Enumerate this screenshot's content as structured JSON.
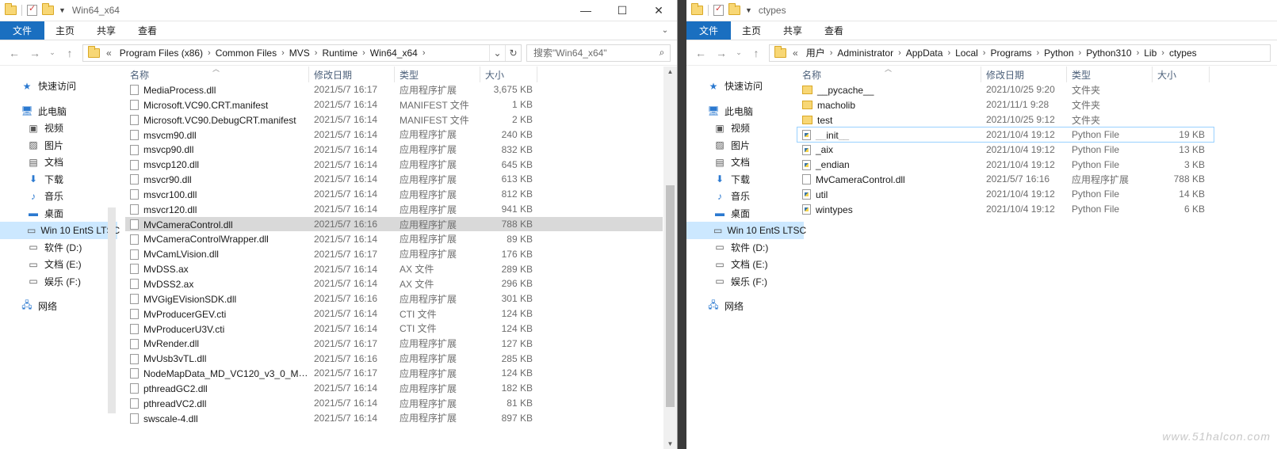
{
  "left": {
    "title": "Win64_x64",
    "ribbon": {
      "file": "文件",
      "tabs": [
        "主页",
        "共享",
        "查看"
      ]
    },
    "address": {
      "prefix": "«",
      "segments": [
        "Program Files (x86)",
        "Common Files",
        "MVS",
        "Runtime",
        "Win64_x64"
      ]
    },
    "search_placeholder": "搜索\"Win64_x64\"",
    "columns": {
      "name": "名称",
      "date": "修改日期",
      "type": "类型",
      "size": "大小"
    },
    "nav": {
      "quick_access": "快速访问",
      "this_pc": "此电脑",
      "videos": "视频",
      "pictures": "图片",
      "documents": "文档",
      "downloads": "下载",
      "music": "音乐",
      "desktop": "桌面",
      "drive_c": "Win 10 EntS LTSC",
      "drive_d": "软件 (D:)",
      "drive_e": "文档 (E:)",
      "drive_f": "娱乐 (F:)",
      "network": "网络"
    },
    "files": [
      {
        "name": "MediaProcess.dll",
        "date": "2021/5/7 16:17",
        "type": "应用程序扩展",
        "size": "3,675 KB"
      },
      {
        "name": "Microsoft.VC90.CRT.manifest",
        "date": "2021/5/7 16:14",
        "type": "MANIFEST 文件",
        "size": "1 KB"
      },
      {
        "name": "Microsoft.VC90.DebugCRT.manifest",
        "date": "2021/5/7 16:14",
        "type": "MANIFEST 文件",
        "size": "2 KB"
      },
      {
        "name": "msvcm90.dll",
        "date": "2021/5/7 16:14",
        "type": "应用程序扩展",
        "size": "240 KB"
      },
      {
        "name": "msvcp90.dll",
        "date": "2021/5/7 16:14",
        "type": "应用程序扩展",
        "size": "832 KB"
      },
      {
        "name": "msvcp120.dll",
        "date": "2021/5/7 16:14",
        "type": "应用程序扩展",
        "size": "645 KB"
      },
      {
        "name": "msvcr90.dll",
        "date": "2021/5/7 16:14",
        "type": "应用程序扩展",
        "size": "613 KB"
      },
      {
        "name": "msvcr100.dll",
        "date": "2021/5/7 16:14",
        "type": "应用程序扩展",
        "size": "812 KB"
      },
      {
        "name": "msvcr120.dll",
        "date": "2021/5/7 16:14",
        "type": "应用程序扩展",
        "size": "941 KB"
      },
      {
        "name": "MvCameraControl.dll",
        "date": "2021/5/7 16:16",
        "type": "应用程序扩展",
        "size": "788 KB"
      },
      {
        "name": "MvCameraControlWrapper.dll",
        "date": "2021/5/7 16:14",
        "type": "应用程序扩展",
        "size": "89 KB"
      },
      {
        "name": "MvCamLVision.dll",
        "date": "2021/5/7 16:17",
        "type": "应用程序扩展",
        "size": "176 KB"
      },
      {
        "name": "MvDSS.ax",
        "date": "2021/5/7 16:14",
        "type": "AX 文件",
        "size": "289 KB"
      },
      {
        "name": "MvDSS2.ax",
        "date": "2021/5/7 16:14",
        "type": "AX 文件",
        "size": "296 KB"
      },
      {
        "name": "MVGigEVisionSDK.dll",
        "date": "2021/5/7 16:16",
        "type": "应用程序扩展",
        "size": "301 KB"
      },
      {
        "name": "MvProducerGEV.cti",
        "date": "2021/5/7 16:14",
        "type": "CTI 文件",
        "size": "124 KB"
      },
      {
        "name": "MvProducerU3V.cti",
        "date": "2021/5/7 16:14",
        "type": "CTI 文件",
        "size": "124 KB"
      },
      {
        "name": "MvRender.dll",
        "date": "2021/5/7 16:17",
        "type": "应用程序扩展",
        "size": "127 KB"
      },
      {
        "name": "MvUsb3vTL.dll",
        "date": "2021/5/7 16:16",
        "type": "应用程序扩展",
        "size": "285 KB"
      },
      {
        "name": "NodeMapData_MD_VC120_v3_0_MVS...",
        "date": "2021/5/7 16:17",
        "type": "应用程序扩展",
        "size": "124 KB"
      },
      {
        "name": "pthreadGC2.dll",
        "date": "2021/5/7 16:14",
        "type": "应用程序扩展",
        "size": "182 KB"
      },
      {
        "name": "pthreadVC2.dll",
        "date": "2021/5/7 16:14",
        "type": "应用程序扩展",
        "size": "81 KB"
      },
      {
        "name": "swscale-4.dll",
        "date": "2021/5/7 16:14",
        "type": "应用程序扩展",
        "size": "897 KB"
      }
    ],
    "selected_index": 9
  },
  "right": {
    "title": "ctypes",
    "ribbon": {
      "file": "文件",
      "tabs": [
        "主页",
        "共享",
        "查看"
      ]
    },
    "address": {
      "prefix": "«",
      "segments": [
        "用户",
        "Administrator",
        "AppData",
        "Local",
        "Programs",
        "Python",
        "Python310",
        "Lib",
        "ctypes"
      ]
    },
    "columns": {
      "name": "名称",
      "date": "修改日期",
      "type": "类型",
      "size": "大小"
    },
    "nav": {
      "quick_access": "快速访问",
      "this_pc": "此电脑",
      "videos": "视频",
      "pictures": "图片",
      "documents": "文档",
      "downloads": "下载",
      "music": "音乐",
      "desktop": "桌面",
      "drive_c": "Win 10 EntS LTSC",
      "drive_d": "软件 (D:)",
      "drive_e": "文档 (E:)",
      "drive_f": "娱乐 (F:)",
      "network": "网络"
    },
    "files": [
      {
        "name": "__pycache__",
        "date": "2021/10/25 9:20",
        "type": "文件夹",
        "size": "",
        "kind": "dir"
      },
      {
        "name": "macholib",
        "date": "2021/11/1 9:28",
        "type": "文件夹",
        "size": "",
        "kind": "dir"
      },
      {
        "name": "test",
        "date": "2021/10/25 9:12",
        "type": "文件夹",
        "size": "",
        "kind": "dir"
      },
      {
        "name": "__init__",
        "date": "2021/10/4 19:12",
        "type": "Python File",
        "size": "19 KB",
        "kind": "py"
      },
      {
        "name": "_aix",
        "date": "2021/10/4 19:12",
        "type": "Python File",
        "size": "13 KB",
        "kind": "py"
      },
      {
        "name": "_endian",
        "date": "2021/10/4 19:12",
        "type": "Python File",
        "size": "3 KB",
        "kind": "py"
      },
      {
        "name": "MvCameraControl.dll",
        "date": "2021/5/7 16:16",
        "type": "应用程序扩展",
        "size": "788 KB",
        "kind": "file"
      },
      {
        "name": "util",
        "date": "2021/10/4 19:12",
        "type": "Python File",
        "size": "14 KB",
        "kind": "py"
      },
      {
        "name": "wintypes",
        "date": "2021/10/4 19:12",
        "type": "Python File",
        "size": "6 KB",
        "kind": "py"
      }
    ],
    "highlight_index": 3
  },
  "watermark": "www.51halcon.com"
}
